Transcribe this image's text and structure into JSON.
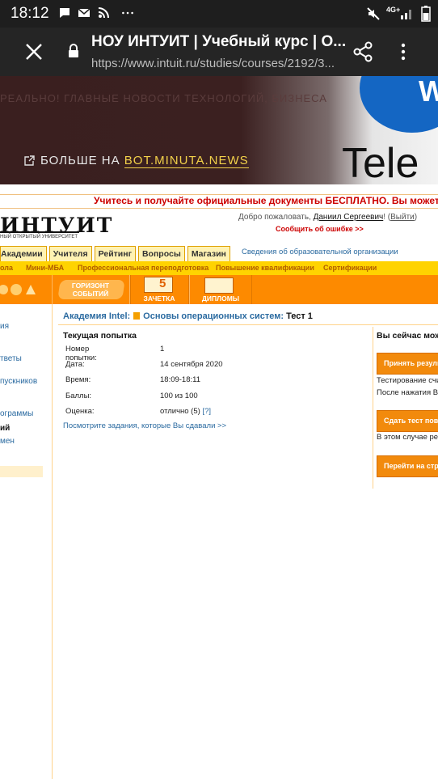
{
  "status_bar": {
    "time": "18:12",
    "icons": [
      "chat-icon",
      "mail-icon",
      "rss-icon",
      "more-icon"
    ],
    "network": "4G+"
  },
  "browser": {
    "title": "НОУ ИНТУИТ | Учебный курс | О...",
    "url": "https://www.intuit.ru/studies/courses/2192/3..."
  },
  "ad": {
    "ticker": "РЕАЛЬНО! ГЛАВНЫЕ НОВОСТИ ТЕХНОЛОГИЙ, БИЗНЕСА",
    "more_prefix": "БОЛЬШЕ НА ",
    "more_link": "BOT.MINUTA.NEWS",
    "brand_letter": "W",
    "brand_word": "Tele"
  },
  "site": {
    "promo": "Учитесь и получайте официальные документы БЕСПЛАТНО. Вы можете по",
    "logo": "ИНТУИТ",
    "logo_sub": "НЫЙ ОТКРЫТЫЙ УНИВЕРСИТЕТ",
    "welcome_prefix": "Добро пожаловать, ",
    "user_name": "Даниил Сергеевич",
    "welcome_mid": "! (",
    "exit": "Выйти",
    "welcome_end": ")",
    "report_error": "Сообщить об ошибке >>",
    "nav": [
      "Академии",
      "Учителя",
      "Рейтинг",
      "Вопросы",
      "Магазин"
    ],
    "svedenia": "Сведения об образовательной организации",
    "subnav": [
      "ола",
      "Мини-МБА",
      "Профессиональная переподготовка",
      "Повышение квалификации",
      "Сертификации"
    ],
    "orange_menu": [
      "ГОРИЗОНТ СОБЫТИЙ",
      "ЗАЧЕТКА",
      "ДИПЛОМЫ"
    ],
    "zachetka_grade": "5"
  },
  "left_nav": {
    "items": [
      "ия",
      "тветы",
      "пускников",
      "ограммы",
      "ий",
      "мен"
    ]
  },
  "breadcrumb": {
    "academy": "Академия Intel:",
    "course": "Основы операционных систем:",
    "test": "Тест 1"
  },
  "attempt": {
    "heading": "Текущая попытка",
    "rows": [
      {
        "label": "Номер попытки:",
        "value": "1"
      },
      {
        "label": "Дата:",
        "value": "14 сентября 2020"
      },
      {
        "label": "Время:",
        "value": "18:09-18:11"
      },
      {
        "label": "Баллы:",
        "value": "100 из 100"
      },
      {
        "label": "Оценка:",
        "value": "отлично (5)",
        "help": "[?]"
      }
    ],
    "view_link": "Посмотрите задания, которые Вы сдавали >>"
  },
  "right_panel": {
    "heading": "Вы сейчас мож",
    "btn_accept": "Принять резуль",
    "text1": "Тестирование счи",
    "text2": "После нажатия Вы",
    "btn_retake": "Сдать тест повт",
    "text3": "В этом случае рез",
    "btn_goto": "Перейти на стра"
  },
  "colors": {
    "orange": "#fd8a00",
    "yellow": "#ffd300",
    "promo_red": "#cc0000",
    "link_blue": "#2a6aa0"
  }
}
